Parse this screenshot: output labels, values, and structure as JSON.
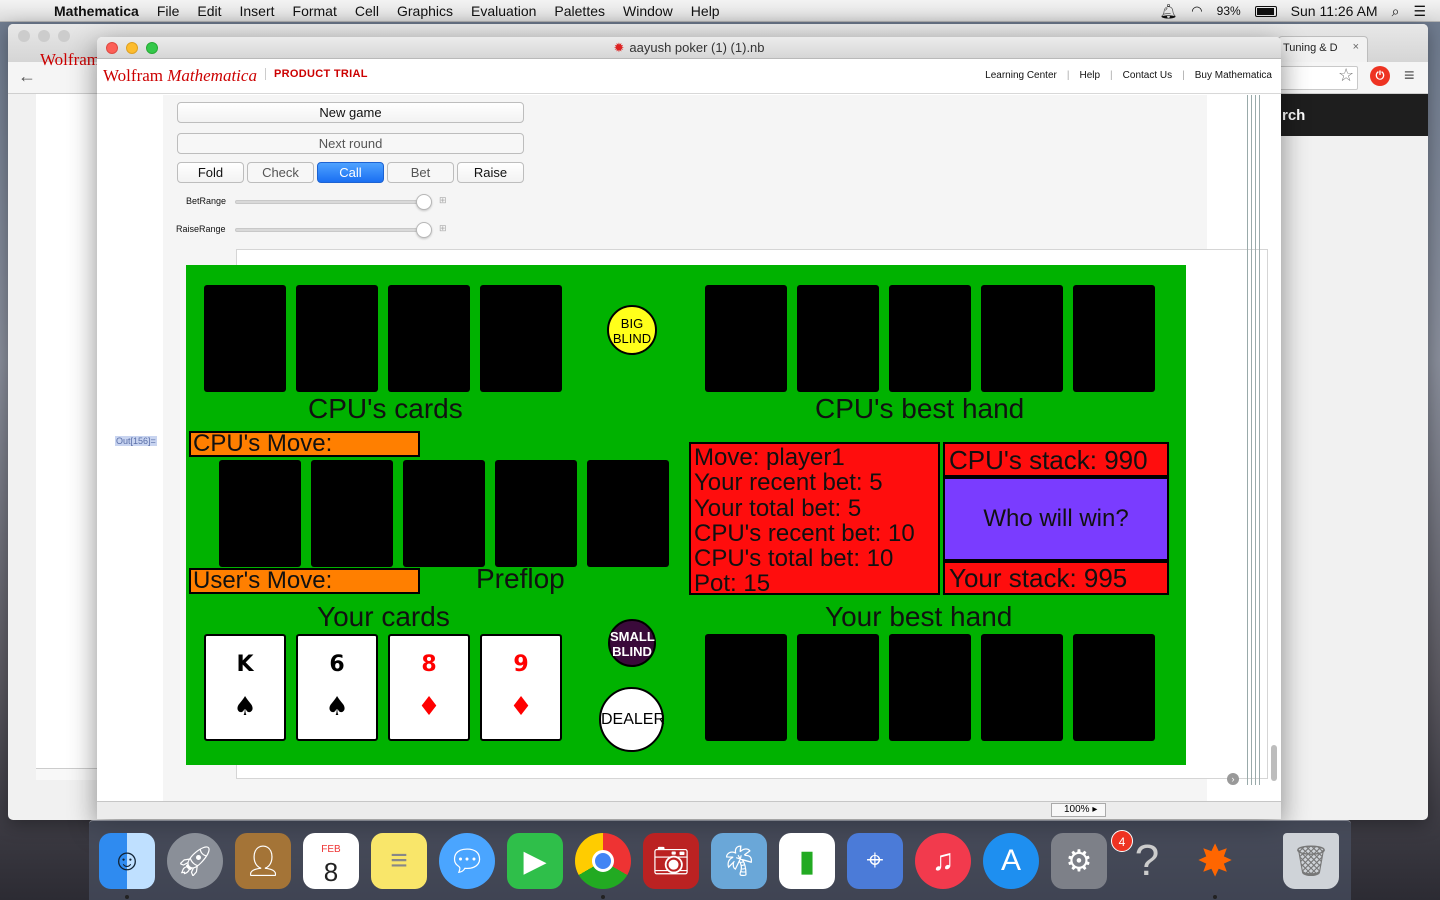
{
  "menubar": {
    "app": "Mathematica",
    "items": [
      "File",
      "Edit",
      "Insert",
      "Format",
      "Cell",
      "Graphics",
      "Evaluation",
      "Palettes",
      "Window",
      "Help"
    ],
    "battery": "93%",
    "clock": "Sun 11:26 AM"
  },
  "chrome": {
    "tab_right": "Tuning & D",
    "left_title": "Wolfram",
    "right_dark_text": "rch"
  },
  "window": {
    "title": "aayush poker (1) (1).nb",
    "brand": {
      "wolfram": "Wolfram",
      "mathematica": "Mathematica",
      "trial": "PRODUCT TRIAL"
    },
    "links": [
      "Learning Center",
      "Help",
      "Contact Us",
      "Buy Mathematica"
    ],
    "zoom": "100%",
    "out_label": "Out[156]="
  },
  "controls": {
    "new_game": "New game",
    "next_round": "Next round",
    "actions": [
      "Fold",
      "Check",
      "Call",
      "Bet",
      "Raise"
    ],
    "selected_action": "Call",
    "bet_range_label": "BetRange",
    "raise_range_label": "RaiseRange",
    "bet_range_value": 1.0,
    "raise_range_value": 1.0
  },
  "table": {
    "colors": {
      "felt": "#00b200",
      "move_box": "#ff7f00",
      "info": "#ff0d0d",
      "who_win": "#7a3cff",
      "big_blind": "#ffff1a",
      "small_blind": "#3a0a3a"
    },
    "cpu_cards_label": "CPU's cards",
    "cpu_best_label": "CPU's best hand",
    "cpu_move_label": "CPU's Move:",
    "user_move_label": "User's Move:",
    "stage": "Preflop",
    "your_cards_label": "Your cards",
    "your_best_label": "Your best hand",
    "big_blind": [
      "BIG",
      "BLIND"
    ],
    "small_blind": [
      "SMALL",
      "BLIND"
    ],
    "dealer": "DEALER",
    "info_lines": [
      "Move: player1",
      "Your recent bet: 5",
      "Your total bet: 5",
      "CPU's recent bet: 10",
      "CPU's total bet: 10",
      "Pot: 15"
    ],
    "cpu_stack": "CPU's stack: 990",
    "who_win": "Who will win?",
    "user_stack": "Your stack: 995",
    "your_cards": [
      {
        "rank": "K",
        "suit": "♠",
        "color": "#000000"
      },
      {
        "rank": "6",
        "suit": "♠",
        "color": "#000000"
      },
      {
        "rank": "8",
        "suit": "♦",
        "color": "#ff0000"
      },
      {
        "rank": "9",
        "suit": "♦",
        "color": "#ff0000"
      }
    ]
  },
  "dock": {
    "calendar_month": "FEB",
    "calendar_day": "8",
    "appstore_badge": "4",
    "icons": [
      "finder-icon",
      "launchpad-icon",
      "contacts-icon",
      "calendar-icon",
      "notes-icon",
      "messages-icon",
      "facetime-icon",
      "chrome-icon",
      "photobooth-icon",
      "iphoto-icon",
      "numbers-icon",
      "keynote-icon",
      "itunes-icon",
      "appstore-icon",
      "system-preferences-icon",
      "help-icon",
      "mathematica-icon",
      "trash-icon"
    ]
  }
}
